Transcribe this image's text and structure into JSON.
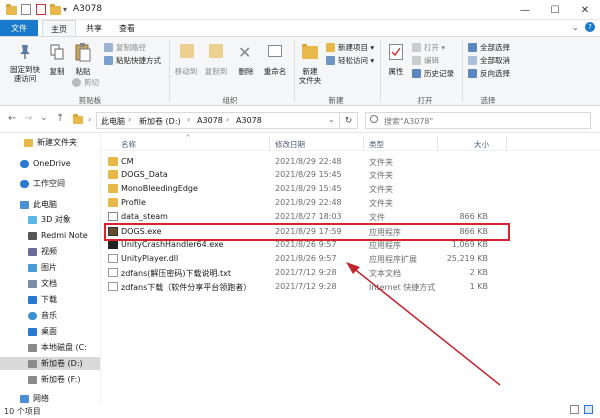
{
  "window": {
    "title": "A3078",
    "minimize": "—",
    "maximize": "☐",
    "close": "✕"
  },
  "tabs": {
    "file": "文件",
    "home": "主页",
    "share": "共享",
    "view": "查看"
  },
  "ribbon": {
    "clipboard": {
      "pin": "固定到快\n速访问",
      "copy": "复制",
      "paste": "粘贴",
      "copy_path": "复制路径",
      "paste_shortcut": "粘贴快捷方式",
      "cut": "剪切",
      "group": "剪贴板"
    },
    "organize": {
      "move_to": "移动到",
      "copy_to": "复制到",
      "delete": "删除",
      "rename": "重命名",
      "group": "组织"
    },
    "new": {
      "new_item": "新建项目 ▾",
      "easy_access": "轻松访问 ▾",
      "new_folder": "新建\n文件夹",
      "group": "新建"
    },
    "open": {
      "properties": "属性",
      "open": "打开 ▾",
      "edit": "编辑",
      "history": "历史记录",
      "group": "打开"
    },
    "select": {
      "select_all": "全部选择",
      "select_none": "全部取消",
      "invert": "反向选择",
      "group": "选择"
    }
  },
  "address": {
    "back": "←",
    "forward": "→",
    "up_menu": "⌄",
    "up": "↑",
    "crumbs": [
      "此电脑",
      "新加卷 (D:)",
      "A3078",
      "A3078"
    ],
    "refresh": "↻",
    "search_placeholder": "搜索\"A3078\""
  },
  "navpane": {
    "items": [
      {
        "label": "新建文件夹",
        "indent": 1
      },
      {
        "label": "OneDrive",
        "indent": 0
      },
      {
        "label": "工作空间",
        "indent": 0
      },
      {
        "label": "此电脑",
        "indent": 0
      },
      {
        "label": "3D 对象",
        "indent": 1
      },
      {
        "label": "Redmi Note",
        "indent": 1
      },
      {
        "label": "视频",
        "indent": 1
      },
      {
        "label": "图片",
        "indent": 1
      },
      {
        "label": "文档",
        "indent": 1
      },
      {
        "label": "下载",
        "indent": 1
      },
      {
        "label": "音乐",
        "indent": 1
      },
      {
        "label": "桌面",
        "indent": 1
      },
      {
        "label": "本地磁盘 (C:",
        "indent": 1
      },
      {
        "label": "新加卷 (D:)",
        "indent": 1
      },
      {
        "label": "新加卷 (F:)",
        "indent": 1
      },
      {
        "label": "网络",
        "indent": 0
      }
    ]
  },
  "columns": {
    "name": "名称",
    "date": "修改日期",
    "type": "类型",
    "size": "大小"
  },
  "files": [
    {
      "name": "CM",
      "date": "2021/8/29 22:48",
      "type": "文件夹",
      "size": "",
      "icon": "folder-icon"
    },
    {
      "name": "DOGS_Data",
      "date": "2021/8/29 15:45",
      "type": "文件夹",
      "size": "",
      "icon": "folder-icon"
    },
    {
      "name": "MonoBleedingEdge",
      "date": "2021/8/29 15:45",
      "type": "文件夹",
      "size": "",
      "icon": "folder-icon"
    },
    {
      "name": "Profile",
      "date": "2021/8/29 22:48",
      "type": "文件夹",
      "size": "",
      "icon": "folder-icon"
    },
    {
      "name": "data_steam",
      "date": "2021/8/27 18:03",
      "type": "文件",
      "size": "866 KB",
      "icon": "file-icon"
    },
    {
      "name": "DOGS.exe",
      "date": "2021/8/29 17:59",
      "type": "应用程序",
      "size": "866 KB",
      "icon": "exe-icon"
    },
    {
      "name": "UnityCrashHandler64.exe",
      "date": "2021/8/26 9:57",
      "type": "应用程序",
      "size": "1,069 KB",
      "icon": "exe-icon"
    },
    {
      "name": "UnityPlayer.dll",
      "date": "2021/8/26 9:57",
      "type": "应用程序扩展",
      "size": "25,219 KB",
      "icon": "dll-icon"
    },
    {
      "name": "zdfans(解压密码)下载说明.txt",
      "date": "2021/7/12 9:28",
      "type": "文本文档",
      "size": "2 KB",
      "icon": "txt-icon"
    },
    {
      "name": "zdfans下载（软件分享平台领跑者）",
      "date": "2021/7/12 9:28",
      "type": "Internet 快捷方式",
      "size": "1 KB",
      "icon": "url-icon"
    }
  ],
  "status": {
    "count": "10 个项目"
  },
  "colors": {
    "accent": "#1979ca",
    "highlight": "#d9232f",
    "arrow": "#c0262e"
  }
}
